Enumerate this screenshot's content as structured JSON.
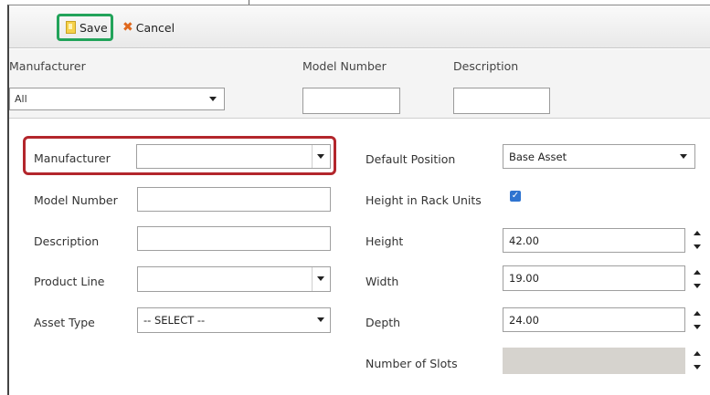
{
  "toolbar": {
    "save_label": "Save",
    "cancel_label": "Cancel"
  },
  "filter": {
    "manufacturer_label": "Manufacturer",
    "model_number_label": "Model Number",
    "description_label": "Description",
    "manufacturer_selected": "All",
    "model_number_value": "",
    "description_value": ""
  },
  "form": {
    "manufacturer_label": "Manufacturer",
    "manufacturer_value": "",
    "model_number_label": "Model Number",
    "model_number_value": "",
    "description_label": "Description",
    "description_value": "",
    "product_line_label": "Product Line",
    "product_line_value": "",
    "asset_type_label": "Asset Type",
    "asset_type_value": "-- SELECT --",
    "default_position_label": "Default Position",
    "default_position_value": "Base Asset",
    "height_in_rack_units_label": "Height in Rack Units",
    "height_in_rack_units_checked": true,
    "height_label": "Height",
    "height_value": "42.00",
    "width_label": "Width",
    "width_value": "19.00",
    "depth_label": "Depth",
    "depth_value": "24.00",
    "number_of_slots_label": "Number of Slots",
    "number_of_slots_value": ""
  },
  "colors": {
    "save_highlight": "#22a35a",
    "manufacturer_highlight": "#b3262c",
    "checkbox": "#2f74d0"
  },
  "icons": {
    "save": "save-document-icon",
    "cancel": "x-cancel-icon"
  }
}
